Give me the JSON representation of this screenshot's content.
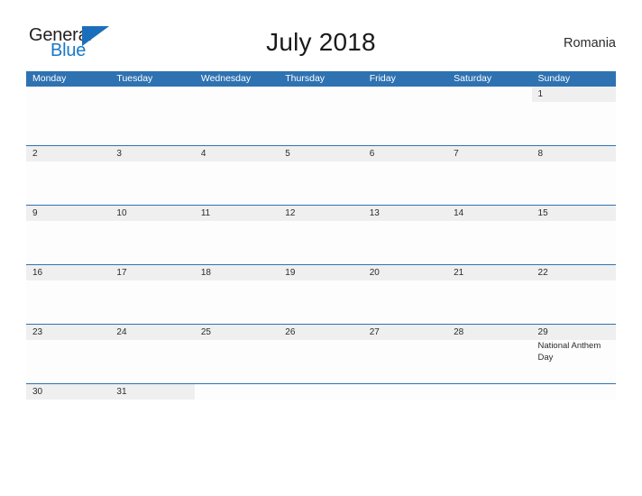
{
  "brand": {
    "name_part1": "General",
    "name_part2": "Blue",
    "flag_icon": "blue-triangle-flag-icon",
    "color_dark": "#231f20",
    "color_blue": "#1878c8"
  },
  "header": {
    "title": "July 2018",
    "region": "Romania"
  },
  "theme": {
    "header_blue": "#2e72b2",
    "day_band_gray": "#efefef",
    "row_divider_blue": "#2e72b2",
    "text_dark": "#2b2b2b",
    "cell_white": "#fdfdfd"
  },
  "calendar": {
    "month": "July",
    "year": "2018",
    "weekday_headers": [
      "Monday",
      "Tuesday",
      "Wednesday",
      "Thursday",
      "Friday",
      "Saturday",
      "Sunday"
    ],
    "weeks": [
      {
        "days": [
          {
            "num": "",
            "events": []
          },
          {
            "num": "",
            "events": []
          },
          {
            "num": "",
            "events": []
          },
          {
            "num": "",
            "events": []
          },
          {
            "num": "",
            "events": []
          },
          {
            "num": "",
            "events": []
          },
          {
            "num": "1",
            "events": []
          }
        ]
      },
      {
        "days": [
          {
            "num": "2",
            "events": []
          },
          {
            "num": "3",
            "events": []
          },
          {
            "num": "4",
            "events": []
          },
          {
            "num": "5",
            "events": []
          },
          {
            "num": "6",
            "events": []
          },
          {
            "num": "7",
            "events": []
          },
          {
            "num": "8",
            "events": []
          }
        ]
      },
      {
        "days": [
          {
            "num": "9",
            "events": []
          },
          {
            "num": "10",
            "events": []
          },
          {
            "num": "11",
            "events": []
          },
          {
            "num": "12",
            "events": []
          },
          {
            "num": "13",
            "events": []
          },
          {
            "num": "14",
            "events": []
          },
          {
            "num": "15",
            "events": []
          }
        ]
      },
      {
        "days": [
          {
            "num": "16",
            "events": []
          },
          {
            "num": "17",
            "events": []
          },
          {
            "num": "18",
            "events": []
          },
          {
            "num": "19",
            "events": []
          },
          {
            "num": "20",
            "events": []
          },
          {
            "num": "21",
            "events": []
          },
          {
            "num": "22",
            "events": []
          }
        ]
      },
      {
        "days": [
          {
            "num": "23",
            "events": []
          },
          {
            "num": "24",
            "events": []
          },
          {
            "num": "25",
            "events": []
          },
          {
            "num": "26",
            "events": []
          },
          {
            "num": "27",
            "events": []
          },
          {
            "num": "28",
            "events": []
          },
          {
            "num": "29",
            "events": [
              "National Anthem Day"
            ]
          }
        ]
      },
      {
        "days": [
          {
            "num": "30",
            "events": []
          },
          {
            "num": "31",
            "events": []
          },
          {
            "num": "",
            "events": []
          },
          {
            "num": "",
            "events": []
          },
          {
            "num": "",
            "events": []
          },
          {
            "num": "",
            "events": []
          },
          {
            "num": "",
            "events": []
          }
        ]
      }
    ]
  }
}
